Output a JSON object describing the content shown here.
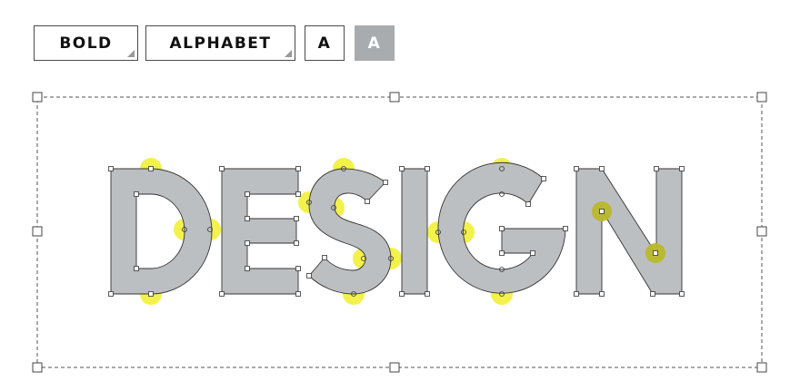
{
  "toolbar": {
    "font_weight_label": "BOLD",
    "charset_label": "ALPHABET",
    "case_outline_label": "A",
    "case_filled_label": "A"
  },
  "canvas": {
    "word": "DESIGN",
    "letters": [
      "D",
      "E",
      "S",
      "I",
      "G",
      "N"
    ]
  },
  "colors": {
    "letter_fill": "#bcbfc1",
    "letter_stroke": "#333333",
    "highlight": "#f1ef2c",
    "selection_frame": "#555555"
  }
}
